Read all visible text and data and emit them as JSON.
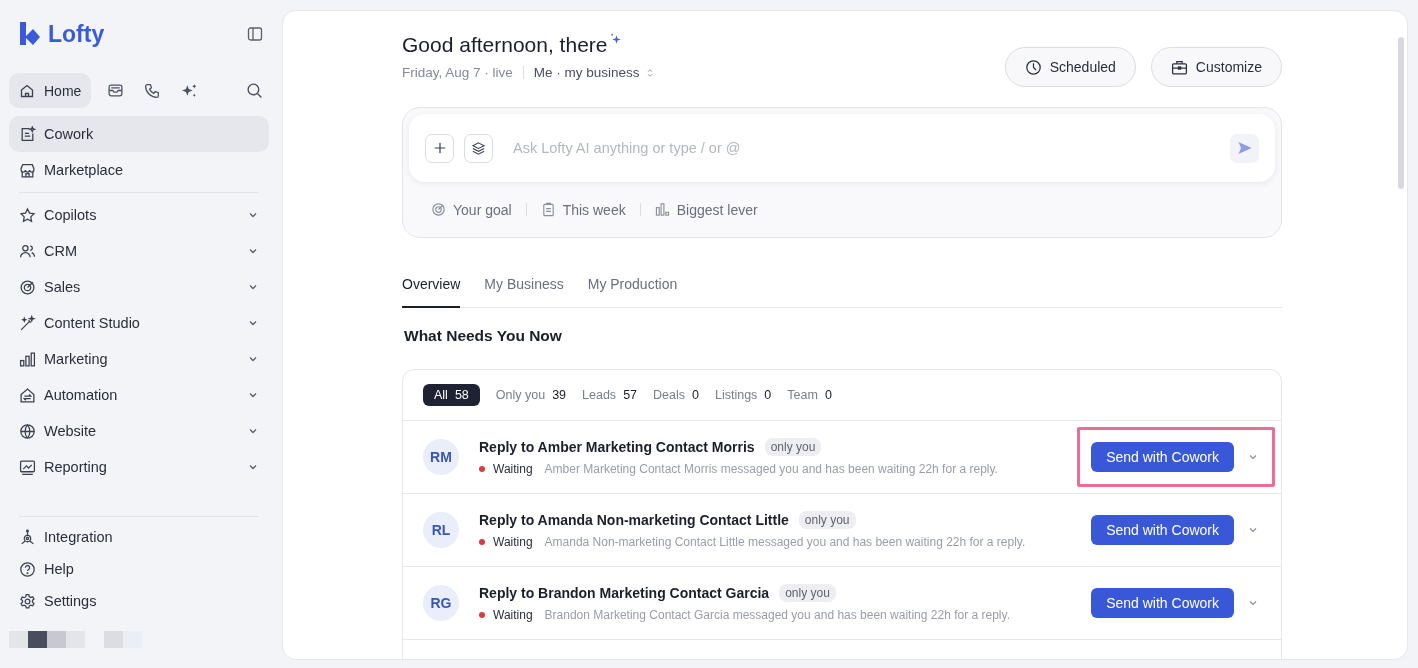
{
  "sidebar": {
    "brand": "Lofty",
    "top_tabs": [
      {
        "label": "Home",
        "selected": true
      }
    ],
    "items": [
      {
        "label": "Cowork",
        "selected": true
      },
      {
        "label": "Marketplace",
        "selected": false
      }
    ],
    "groups": [
      {
        "label": "Copilots",
        "expanded": false
      },
      {
        "label": "CRM",
        "expanded": false
      },
      {
        "label": "Sales",
        "expanded": false
      },
      {
        "label": "Content Studio",
        "expanded": false
      },
      {
        "label": "Marketing",
        "expanded": false
      },
      {
        "label": "Automation",
        "expanded": false
      },
      {
        "label": "Website",
        "expanded": false
      },
      {
        "label": "Reporting",
        "expanded": false
      }
    ],
    "footer": [
      {
        "label": "Integration"
      },
      {
        "label": "Help"
      },
      {
        "label": "Settings"
      }
    ]
  },
  "header": {
    "greeting": "Good afternoon, there",
    "date": "Friday, Aug 7 · live",
    "scope": "Me · my business",
    "buttons": [
      {
        "label": "Scheduled"
      },
      {
        "label": "Customize"
      }
    ]
  },
  "prompt": {
    "placeholder": "Ask Lofty AI anything or type / or @",
    "suggestions": [
      {
        "label": "Your goal"
      },
      {
        "label": "This week"
      },
      {
        "label": "Biggest lever"
      }
    ]
  },
  "tabs": [
    {
      "label": "Overview",
      "selected": true
    },
    {
      "label": "My Business",
      "selected": false
    },
    {
      "label": "My Production",
      "selected": false
    }
  ],
  "section_title": "What Needs You Now",
  "filters": [
    {
      "label": "All",
      "count": "58",
      "selected": true
    },
    {
      "label": "Only you",
      "count": "39",
      "selected": false
    },
    {
      "label": "Leads",
      "count": "57",
      "selected": false
    },
    {
      "label": "Deals",
      "count": "0",
      "selected": false
    },
    {
      "label": "Listings",
      "count": "0",
      "selected": false
    },
    {
      "label": "Team",
      "count": "0",
      "selected": false
    }
  ],
  "tasks": [
    {
      "initials": "RM",
      "title": "Reply to Amber Marketing Contact Morris",
      "tag": "only you",
      "status": "Waiting",
      "message": "Amber Marketing Contact Morris messaged you and has been waiting 22h for a reply.",
      "action": "Send with Cowork",
      "highlighted": true
    },
    {
      "initials": "RL",
      "title": "Reply to Amanda Non-marketing Contact Little",
      "tag": "only you",
      "status": "Waiting",
      "message": "Amanda Non-marketing Contact Little messaged you and has been waiting 22h for a reply.",
      "action": "Send with Cowork",
      "highlighted": false
    },
    {
      "initials": "RG",
      "title": "Reply to Brandon Marketing Contact Garcia",
      "tag": "only you",
      "status": "Waiting",
      "message": "Brandon Marketing Contact Garcia messaged you and has been waiting 22h for a reply.",
      "action": "Send with Cowork",
      "highlighted": false
    }
  ]
}
